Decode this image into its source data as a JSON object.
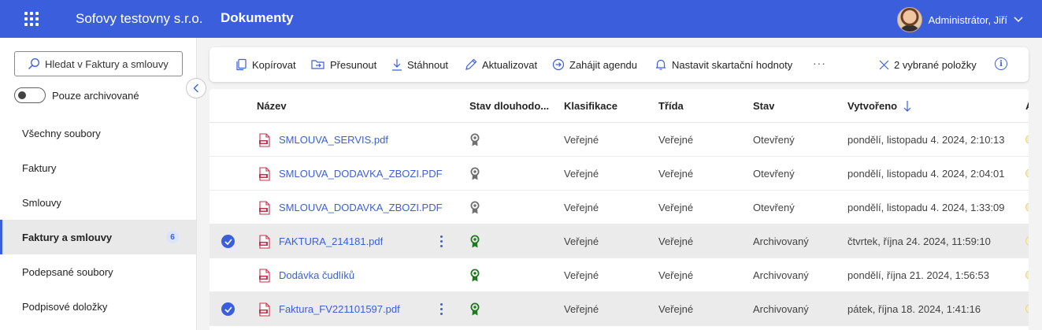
{
  "topbar": {
    "org_name": "Sofovy testovny s.r.o.",
    "module_title": "Dokumenty",
    "user_name": "Administrátor, Jiří",
    "colors": {
      "brand": "#3b5fdc"
    }
  },
  "sidebar": {
    "search_placeholder": "Hledat v Faktury a smlouvy",
    "archive_toggle_label": "Pouze archivované",
    "archive_toggle_on": false,
    "items": [
      {
        "label": "Všechny soubory"
      },
      {
        "label": "Faktury"
      },
      {
        "label": "Smlouvy"
      },
      {
        "label": "Faktury a smlouvy",
        "count": "6",
        "active": true
      },
      {
        "label": "Podepsané soubory"
      },
      {
        "label": "Podpisové doložky"
      }
    ]
  },
  "commands": {
    "copy": "Kopírovat",
    "move": "Přesunout",
    "download": "Stáhnout",
    "update": "Aktualizovat",
    "start_agenda": "Zahájit agendu",
    "set_shredding": "Nastavit skartační hodnoty",
    "more": "···",
    "selected_count": "2 vybrané položky",
    "info": "i"
  },
  "table": {
    "columns": {
      "name": "Název",
      "longterm": "Stav dlouhodo...",
      "classification": "Klasifikace",
      "class": "Třída",
      "state": "Stav",
      "created": "Vytvořeno",
      "next": "A"
    },
    "sort": {
      "column": "created",
      "direction": "descending"
    },
    "rows": [
      {
        "name": "SMLOUVA_SERVIS.pdf",
        "longterm_status": "grey",
        "classification": "Veřejné",
        "class": "Veřejné",
        "state": "Otevřený",
        "created": "pondělí, listopadu 4. 2024, 2:10:13",
        "selected": false
      },
      {
        "name": "SMLOUVA_DODAVKA_ZBOZI.PDF",
        "longterm_status": "grey",
        "classification": "Veřejné",
        "class": "Veřejné",
        "state": "Otevřený",
        "created": "pondělí, listopadu 4. 2024, 2:04:01",
        "selected": false
      },
      {
        "name": "SMLOUVA_DODAVKA_ZBOZI.PDF",
        "longterm_status": "grey",
        "classification": "Veřejné",
        "class": "Veřejné",
        "state": "Otevřený",
        "created": "pondělí, listopadu 4. 2024, 1:33:09",
        "selected": false
      },
      {
        "name": "FAKTURA_214181.pdf",
        "longterm_status": "green",
        "classification": "Veřejné",
        "class": "Veřejné",
        "state": "Archivovaný",
        "created": "čtvrtek, října 24. 2024, 11:59:10",
        "selected": true
      },
      {
        "name": "Dodávka čudlíků",
        "longterm_status": "green",
        "classification": "Veřejné",
        "class": "Veřejné",
        "state": "Archivovaný",
        "created": "pondělí, října 21. 2024, 1:56:53",
        "selected": false
      },
      {
        "name": "Faktura_FV221101597.pdf",
        "longterm_status": "green",
        "classification": "Veřejné",
        "class": "Veřejné",
        "state": "Archivovaný",
        "created": "pátek, října 18. 2024, 1:41:16",
        "selected": true
      }
    ],
    "status_colors": {
      "grey": "#707070",
      "green": "#1e7a1e",
      "pdf": "#c4314b"
    }
  }
}
